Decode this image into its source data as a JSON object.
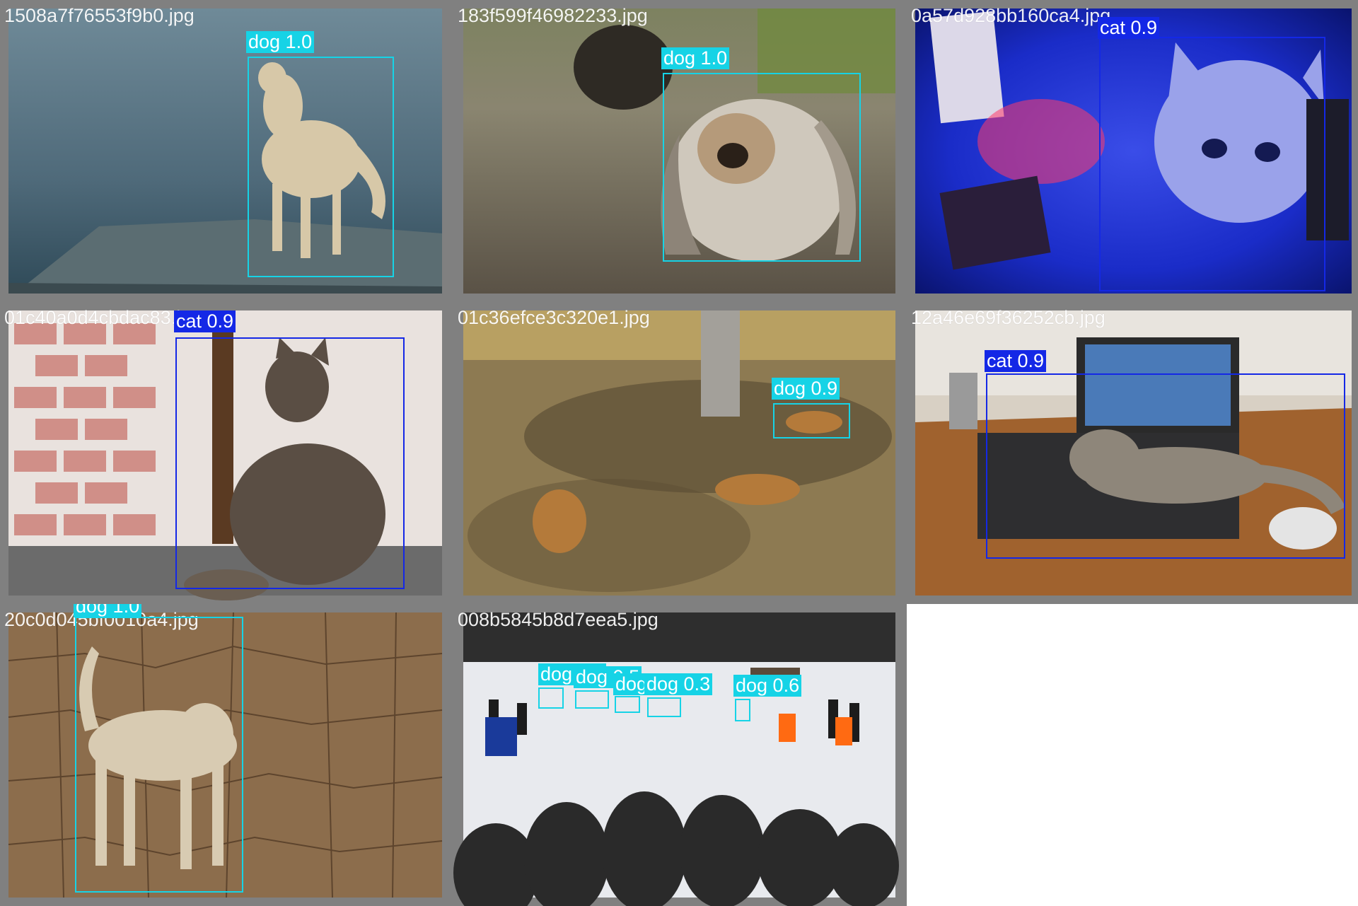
{
  "colors": {
    "dog": "#16d3e6",
    "cat": "#1428e6",
    "tile_border": "#808080"
  },
  "tiles": [
    {
      "filename": "1508a7f76553f9b0.jpg",
      "scene": "lake",
      "detections": [
        {
          "label": "dog 1.0",
          "class": "dog"
        }
      ]
    },
    {
      "filename": "183f599f46982233.jpg",
      "scene": "gravel",
      "detections": [
        {
          "label": "dog 1.0",
          "class": "dog"
        }
      ]
    },
    {
      "filename": "0a57d928bb160ca4.jpg",
      "scene": "blue-room",
      "detections": [
        {
          "label": "cat 0.9",
          "class": "cat"
        }
      ]
    },
    {
      "filename": "01c40a0d4cbdac83.jpg",
      "scene": "window",
      "detections": [
        {
          "label": "cat 0.9",
          "class": "cat"
        }
      ]
    },
    {
      "filename": "01c36efce3c320e1.jpg",
      "scene": "park",
      "detections": [
        {
          "label": "dog 0.9",
          "class": "dog"
        }
      ]
    },
    {
      "filename": "12a46e69f36252cb.jpg",
      "scene": "desk",
      "detections": [
        {
          "label": "cat 0.9",
          "class": "cat"
        }
      ]
    },
    {
      "filename": "20c0d045bf0010a4.jpg",
      "scene": "cracked-earth",
      "detections": [
        {
          "label": "dog 1.0",
          "class": "dog"
        }
      ]
    },
    {
      "filename": "008b5845b8d7eea5.jpg",
      "scene": "snow",
      "detections": [
        {
          "label": "dog 0.3",
          "class": "dog"
        },
        {
          "label": "dog 0.5",
          "class": "dog"
        },
        {
          "label": "dog",
          "class": "dog"
        },
        {
          "label": "dog 0.3",
          "class": "dog"
        },
        {
          "label": "dog 0.6",
          "class": "dog"
        }
      ]
    }
  ]
}
